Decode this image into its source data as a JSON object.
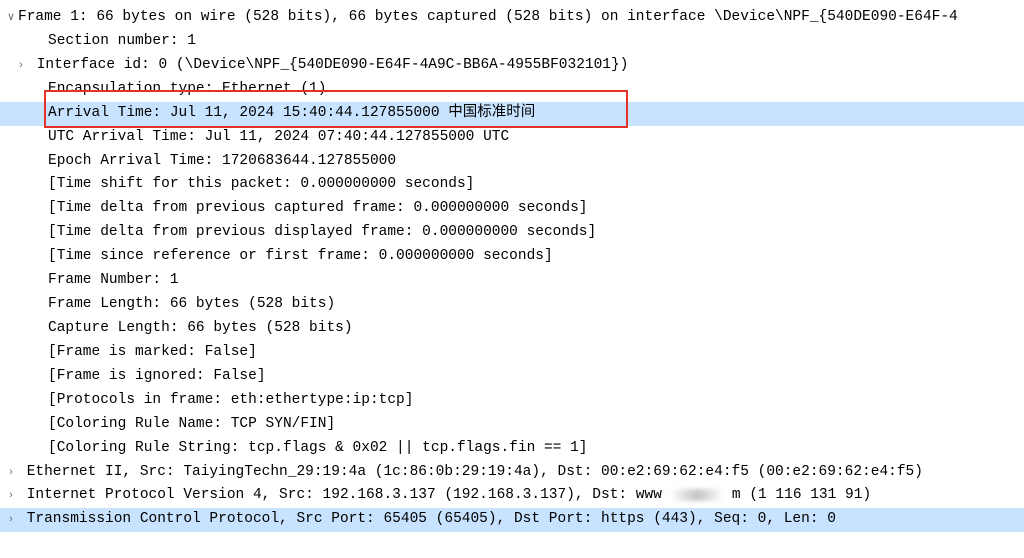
{
  "frame": {
    "summary": "Frame 1: 66 bytes on wire (528 bits), 66 bytes captured (528 bits) on interface \\Device\\NPF_{540DE090-E64F-4",
    "section_number": "Section number: 1",
    "interface_id": "Interface id: 0 (\\Device\\NPF_{540DE090-E64F-4A9C-BB6A-4955BF032101})",
    "encapsulation": "Encapsulation type: Ethernet (1)",
    "arrival_time": "Arrival Time: Jul 11, 2024 15:40:44.127855000 中国标准时间",
    "utc_arrival_time": "UTC Arrival Time: Jul 11, 2024 07:40:44.127855000 UTC",
    "epoch_arrival_time": "Epoch Arrival Time: 1720683644.127855000",
    "time_shift": "[Time shift for this packet: 0.000000000 seconds]",
    "time_delta_captured": "[Time delta from previous captured frame: 0.000000000 seconds]",
    "time_delta_displayed": "[Time delta from previous displayed frame: 0.000000000 seconds]",
    "time_since_ref": "[Time since reference or first frame: 0.000000000 seconds]",
    "frame_number": "Frame Number: 1",
    "frame_length": "Frame Length: 66 bytes (528 bits)",
    "capture_length": "Capture Length: 66 bytes (528 bits)",
    "frame_marked": "[Frame is marked: False]",
    "frame_ignored": "[Frame is ignored: False]",
    "protocols": "[Protocols in frame: eth:ethertype:ip:tcp]",
    "coloring_rule_name": "[Coloring Rule Name: TCP SYN/FIN]",
    "coloring_rule_string": "[Coloring Rule String: tcp.flags & 0x02 || tcp.flags.fin == 1]"
  },
  "ethernet": "Ethernet II, Src: TaiyingTechn_29:19:4a (1c:86:0b:29:19:4a), Dst: 00:e2:69:62:e4:f5 (00:e2:69:62:e4:f5)",
  "ip_prefix": "Internet Protocol Version 4, Src: 192.168.3.137 (192.168.3.137), Dst: www",
  "ip_suffix": "m (1 116 131 91)",
  "tcp": "Transmission Control Protocol, Src Port: 65405 (65405), Dst Port: https (443), Seq: 0, Len: 0"
}
